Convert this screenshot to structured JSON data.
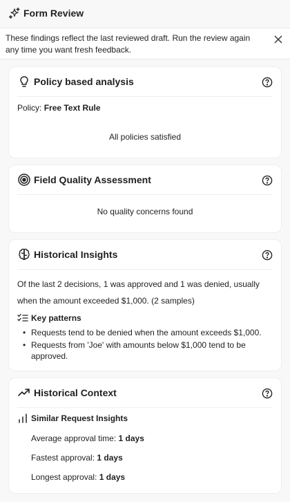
{
  "header": {
    "title": "Form Review",
    "icon": "sparkle-icon"
  },
  "notice": {
    "text": "These findings reflect the last reviewed draft. Run the review again any time you want fresh feedback.",
    "close_icon": "close-icon"
  },
  "policy_card": {
    "title": "Policy based analysis",
    "icon": "lightbulb-icon",
    "policy_label": "Policy:",
    "policy_name": "Free Text Rule",
    "status": "All policies satisfied"
  },
  "quality_card": {
    "title": "Field Quality Assessment",
    "icon": "target-icon",
    "status": "No quality concerns found"
  },
  "insights_card": {
    "title": "Historical Insights",
    "icon": "brain-icon",
    "summary": "Of the last 2 decisions, 1 was approved and 1 was denied, usually when the amount exceeded $1,000. (2 samples)",
    "key_patterns_label": "Key patterns",
    "patterns": [
      "Requests tend to be denied when the amount exceeds $1,000.",
      "Requests from 'Joe' with amounts below $1,000 tend to be approved."
    ]
  },
  "context_card": {
    "title": "Historical Context",
    "icon": "trending-up-icon",
    "section_label": "Similar Request Insights",
    "stats": [
      {
        "label": "Average approval time:",
        "value": "1 days"
      },
      {
        "label": "Fastest approval:",
        "value": "1 days"
      },
      {
        "label": "Longest approval:",
        "value": "1 days"
      }
    ]
  }
}
